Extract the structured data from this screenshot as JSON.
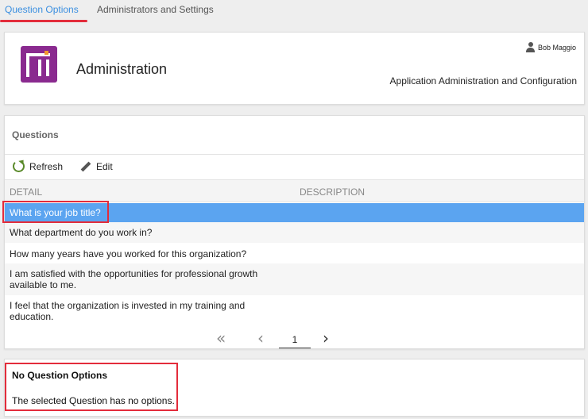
{
  "tabs": [
    {
      "label": "Question Options",
      "active": true
    },
    {
      "label": "Administrators and Settings",
      "active": false
    }
  ],
  "header": {
    "title": "Administration",
    "user_name": "Bob Maggio",
    "subtitle": "Application Administration and Configuration",
    "logo_icon": "ni-logo",
    "logo_color": "#8a2a8f",
    "logo_accent": "#f29a2e"
  },
  "questions": {
    "panel_title": "Questions",
    "toolbar": {
      "refresh_label": "Refresh",
      "edit_label": "Edit"
    },
    "columns": [
      "DETAIL",
      "DESCRIPTION"
    ],
    "rows": [
      {
        "detail": "What is your job title?",
        "selected": true
      },
      {
        "detail": "What department do you work in?",
        "selected": false
      },
      {
        "detail": "How many years have you worked for this organization?",
        "selected": false
      },
      {
        "detail": "I am satisfied with the opportunities for professional growth available to me.",
        "selected": false
      },
      {
        "detail": "I feel that the organization is invested in my training and education.",
        "selected": false
      }
    ],
    "pager": {
      "first": "«",
      "prev": "‹",
      "page": "1",
      "next": "›"
    }
  },
  "options": {
    "title": "No Question Options",
    "message": "The selected Question has no options."
  },
  "colors": {
    "accent": "#3b8fe0",
    "selected_row": "#5ba4f0",
    "highlight": "#e32c3b"
  }
}
